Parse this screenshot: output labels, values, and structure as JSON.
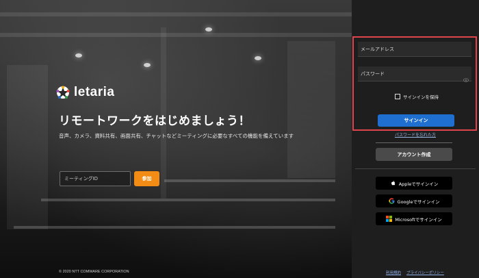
{
  "hero": {
    "brand": "letaria",
    "headline": "リモートワークをはじめましょう！",
    "subline": "音声、カメラ、資料共有、画面共有、チャットなどミーティングに必要なすべての機能を備えています",
    "meeting_placeholder": "ミーティングID",
    "join_label": "参加",
    "copyright": "© 2020 NTT COMWARE CORPORATION"
  },
  "login": {
    "email_placeholder": "メールアドレス",
    "password_placeholder": "パスワード",
    "keep_signed_in": "サインインを保持",
    "signin_label": "サインイン",
    "forgot_password": "パスワードを忘れた方",
    "create_account": "アカウント作成"
  },
  "oauth": {
    "apple": "Appleでサインイン",
    "google": "Googleでサインイン",
    "microsoft": "Microsoftでサインイン"
  },
  "footer": {
    "terms": "利用規約",
    "privacy": "プライバシーポリシー"
  },
  "colors": {
    "highlight": "#e0454b",
    "primary": "#1f6fd1",
    "join": "#f28c14"
  }
}
